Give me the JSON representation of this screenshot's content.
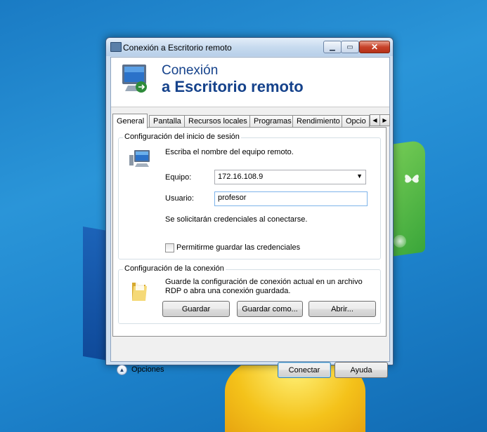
{
  "window": {
    "title": "Conexión a Escritorio remoto",
    "min_icon": "minimize-icon",
    "max_icon": "maximize-icon",
    "close_icon": "close-icon",
    "close_glyph": "✕",
    "min_glyph": "▁",
    "max_glyph": "▭"
  },
  "banner": {
    "line1": "Conexión",
    "line2": "a Escritorio remoto"
  },
  "tabs": {
    "items": [
      "General",
      "Pantalla",
      "Recursos locales",
      "Programas",
      "Rendimiento",
      "Opcio"
    ],
    "active": "General",
    "scroll_left": "◀",
    "scroll_right": "▶"
  },
  "login_group": {
    "title": "Configuración del inicio de sesión",
    "instruction": "Escriba el nombre del equipo remoto.",
    "computer_label": "Equipo:",
    "computer_value": "172.16.108.9",
    "dropdown_glyph": "▼",
    "user_label": "Usuario:",
    "user_value": "profesor",
    "credentials_note": "Se solicitarán credenciales al conectarse.",
    "save_credentials_label": "Permitirme guardar las credenciales",
    "save_credentials_checked": false
  },
  "connection_group": {
    "title": "Configuración de la conexión",
    "description_line1": "Guarde la configuración de conexión actual en un archivo",
    "description_line2": "RDP o abra una conexión guardada.",
    "save_button": "Guardar",
    "save_as_button": "Guardar como...",
    "open_button": "Abrir..."
  },
  "footer": {
    "options_label": "Opciones",
    "options_glyph": "▲",
    "connect_button": "Conectar",
    "help_button": "Ayuda"
  },
  "colors": {
    "banner_text": "#15428b",
    "desktop": "#1f86cf"
  }
}
